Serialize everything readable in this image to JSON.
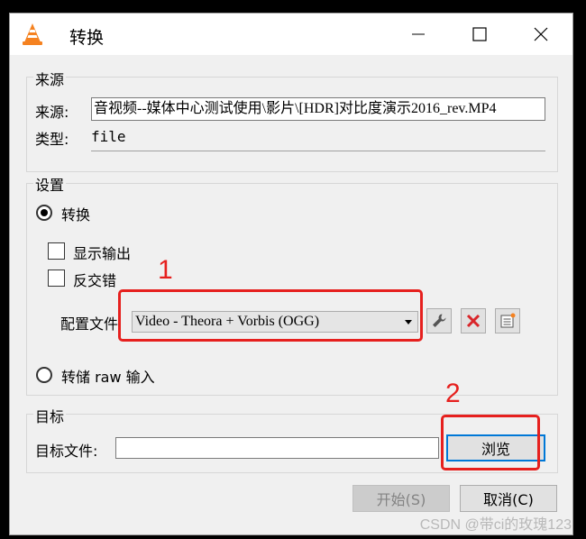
{
  "window": {
    "title": "转换",
    "icon": "vlc-cone-icon",
    "controls": {
      "minimize": "minimize-icon",
      "maximize": "maximize-icon",
      "close": "close-icon"
    }
  },
  "source": {
    "group_title": "来源",
    "source_label": "来源:",
    "source_value": "音视频--媒体中心测试使用\\影片\\[HDR]对比度演示2016_rev.MP4",
    "type_label": "类型:",
    "type_value": "file"
  },
  "settings": {
    "group_title": "设置",
    "convert_label": "转换",
    "convert_selected": true,
    "show_output_label": "显示输出",
    "show_output_checked": false,
    "deinterlace_label": "反交错",
    "deinterlace_checked": false,
    "profile_label": "配置文件",
    "profile_value": "Video - Theora + Vorbis (OGG)",
    "edit_profile_icon": "wrench-icon",
    "delete_profile_icon": "delete-x-icon",
    "new_profile_icon": "new-profile-icon",
    "dump_raw_label": "转储 raw 输入",
    "dump_raw_selected": false
  },
  "target": {
    "group_title": "目标",
    "file_label": "目标文件:",
    "file_value": "",
    "browse_label": "浏览"
  },
  "actions": {
    "start_label": "开始(S)",
    "cancel_label": "取消(C)"
  },
  "annotations": {
    "marker_1": "1",
    "marker_2": "2",
    "color": "#e6201e"
  },
  "watermark": "CSDN @带ci的玫瑰123"
}
